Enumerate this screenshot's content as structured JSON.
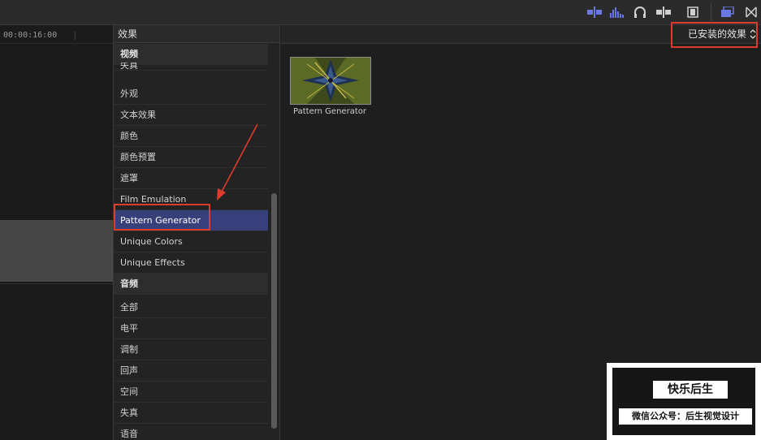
{
  "timeline": {
    "timecode": "00:00:16:00"
  },
  "effects_browser": {
    "title": "效果",
    "categories": [
      {
        "label": "视频",
        "group": true
      },
      {
        "label": "失真"
      },
      {
        "label": "外观"
      },
      {
        "label": "文本效果"
      },
      {
        "label": "颜色"
      },
      {
        "label": "颜色预置"
      },
      {
        "label": "遮罩"
      },
      {
        "label": "Film Emulation"
      },
      {
        "label": "Pattern Generator",
        "selected": true
      },
      {
        "label": "Unique Colors"
      },
      {
        "label": "Unique Effects"
      },
      {
        "label": "音频",
        "group": true
      },
      {
        "label": "全部"
      },
      {
        "label": "电平"
      },
      {
        "label": "调制"
      },
      {
        "label": "回声"
      },
      {
        "label": "空间"
      },
      {
        "label": "失真"
      },
      {
        "label": "语音"
      }
    ]
  },
  "browser": {
    "filter_label": "已安装的效果",
    "items": [
      {
        "label": "Pattern Generator"
      }
    ]
  },
  "watermark": {
    "title": "快乐后生",
    "subtitle": "微信公众号：后生视觉设计"
  },
  "toolbar_icons": [
    "clip-connect-icon",
    "audio-waveform-icon",
    "headphones-icon",
    "skimming-icon",
    "filmstrip-icon",
    "browser-toggle-icon",
    "transitions-icon"
  ],
  "colors": {
    "selection": "#37407a",
    "annotation": "#e03a2a",
    "accent_icon": "#6b78e0"
  }
}
